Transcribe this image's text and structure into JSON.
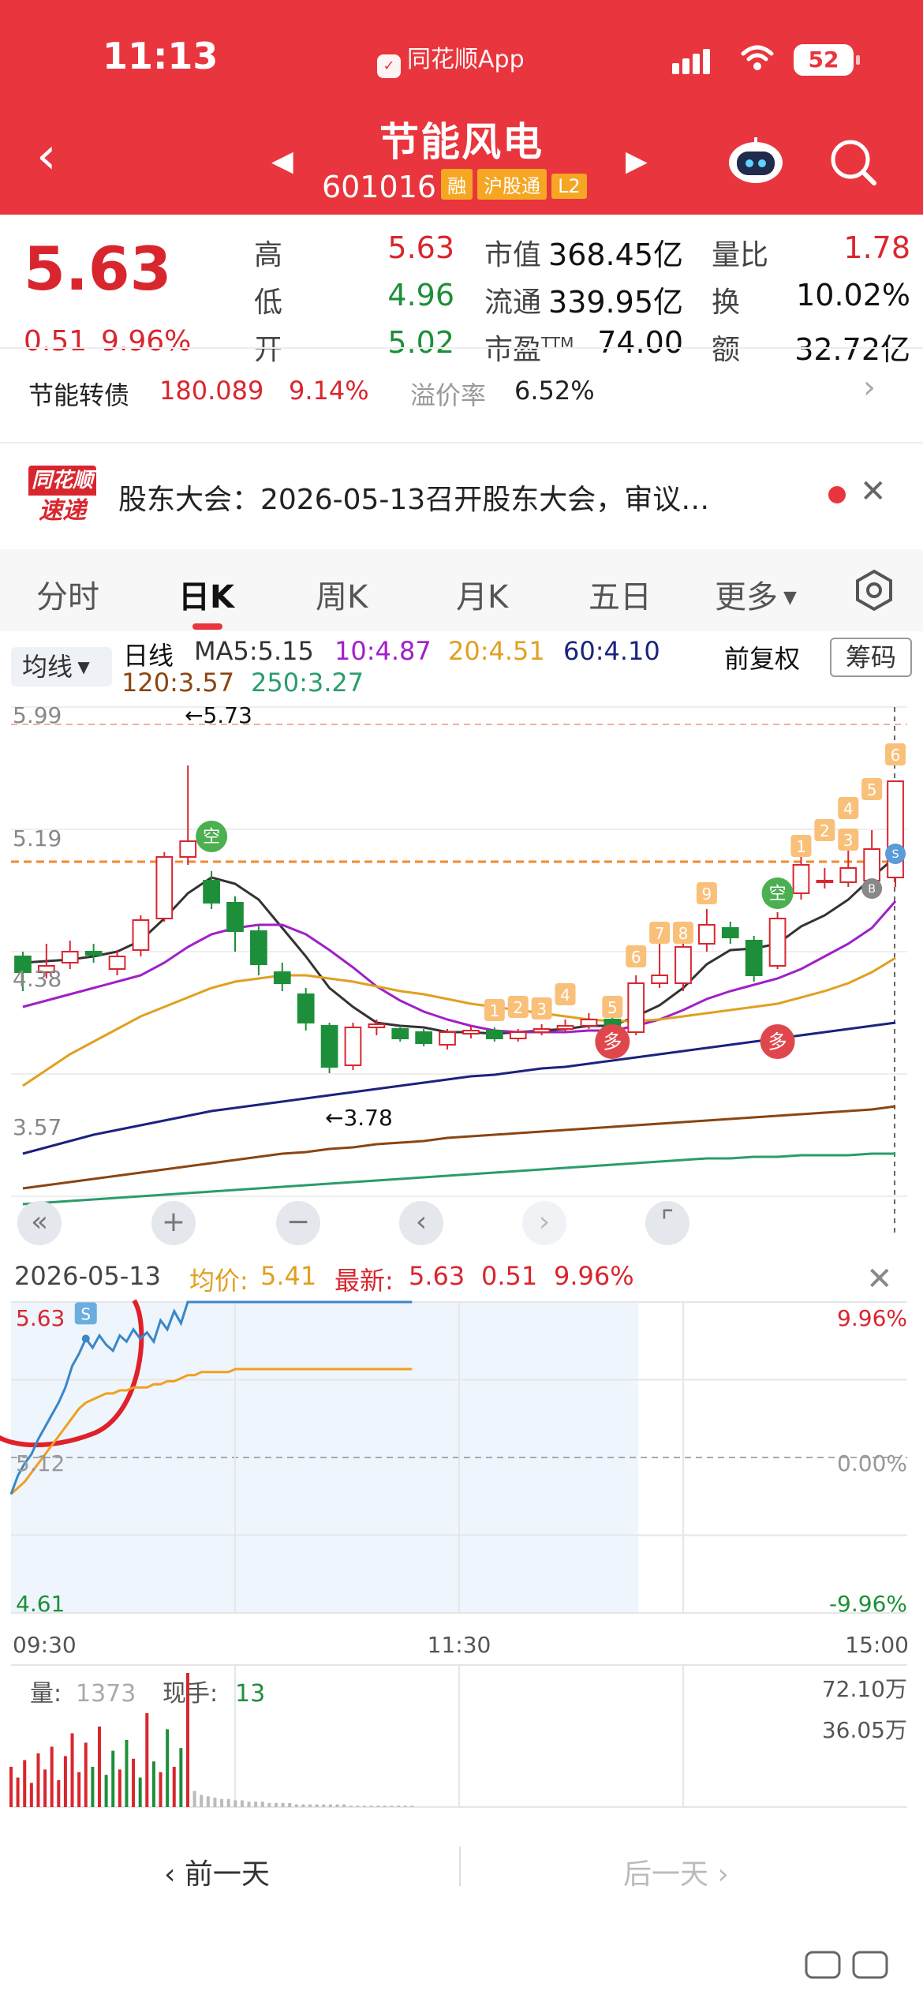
{
  "status_bar": {
    "time": "11:13",
    "app_name": "同花顺App",
    "battery": "52"
  },
  "header": {
    "stock_name": "节能风电",
    "stock_code": "601016",
    "tags": [
      "融",
      "沪股通",
      "L2"
    ]
  },
  "quote": {
    "price": "5.63",
    "change": "0.51",
    "change_pct": "9.96%",
    "high_label": "高",
    "high": "5.63",
    "low_label": "低",
    "low": "4.96",
    "open_label": "开",
    "open": "5.02",
    "mktcap_label": "市值",
    "mktcap": "368.45亿",
    "float_label": "流通",
    "float": "339.95亿",
    "pe_label": "市盈",
    "pe_suffix": "TTM",
    "pe": "74.00",
    "volratio_label": "量比",
    "volratio": "1.78",
    "turnover_label": "换",
    "turnover": "10.02%",
    "amount_label": "额",
    "amount": "32.72亿"
  },
  "bond": {
    "name": "节能转债",
    "price": "180.089",
    "pct": "9.14%",
    "premium_label": "溢价率",
    "premium": "6.52%"
  },
  "news": {
    "logo_top": "同花顺",
    "logo_bottom": "速递",
    "text": "股东大会：2026-05-13召开股东大会，审议…"
  },
  "tabs": [
    "分时",
    "日K",
    "周K",
    "月K",
    "五日",
    "更多"
  ],
  "ma_bar": {
    "select": "均线",
    "period": "日线",
    "ma5": "MA5:5.15",
    "ma10": "10:4.87",
    "ma20": "20:4.51",
    "ma60": "60:4.10",
    "ma120": "120:3.57",
    "ma250": "250:3.27",
    "adjust": "前复权",
    "chips": "筹码"
  },
  "kline": {
    "y_labels": [
      "5.99",
      "5.19",
      "4.38",
      "3.57"
    ],
    "high_note": "←5.73",
    "low_note": "←3.78",
    "markers": [
      "空",
      "多",
      "S",
      "B"
    ],
    "counts": [
      "1",
      "2",
      "3",
      "4",
      "5",
      "6",
      "7",
      "8",
      "9"
    ]
  },
  "kline_data": {
    "type": "candlestick",
    "candles": [
      [
        4.52,
        4.42,
        4.55,
        4.3
      ],
      [
        4.42,
        4.46,
        4.6,
        4.38
      ],
      [
        4.48,
        4.55,
        4.62,
        4.44
      ],
      [
        4.55,
        4.53,
        4.6,
        4.48
      ],
      [
        4.44,
        4.52,
        4.56,
        4.4
      ],
      [
        4.56,
        4.75,
        4.78,
        4.52
      ],
      [
        4.76,
        5.15,
        5.18,
        4.74
      ],
      [
        5.15,
        5.25,
        5.73,
        5.1
      ],
      [
        5.0,
        4.86,
        5.06,
        4.82
      ],
      [
        4.86,
        4.68,
        4.9,
        4.55
      ],
      [
        4.68,
        4.47,
        4.72,
        4.4
      ],
      [
        4.42,
        4.35,
        4.48,
        4.3
      ],
      [
        4.28,
        4.1,
        4.32,
        4.05
      ],
      [
        4.08,
        3.82,
        4.1,
        3.78
      ],
      [
        3.83,
        4.07,
        4.1,
        3.8
      ],
      [
        4.07,
        4.09,
        4.12,
        4.02
      ],
      [
        4.06,
        4.0,
        4.08,
        3.98
      ],
      [
        4.04,
        3.97,
        4.06,
        3.95
      ],
      [
        3.96,
        4.04,
        4.06,
        3.93
      ],
      [
        4.03,
        4.05,
        4.08,
        4.0
      ],
      [
        4.05,
        4.0,
        4.07,
        3.98
      ],
      [
        4.0,
        4.04,
        4.06,
        3.98
      ],
      [
        4.04,
        4.06,
        4.09,
        4.02
      ],
      [
        4.06,
        4.08,
        4.12,
        4.04
      ],
      [
        4.08,
        4.12,
        4.16,
        4.06
      ],
      [
        4.12,
        4.04,
        4.14,
        4.02
      ],
      [
        4.04,
        4.35,
        4.4,
        4.02
      ],
      [
        4.35,
        4.4,
        4.6,
        4.32
      ],
      [
        4.35,
        4.58,
        4.62,
        4.3
      ],
      [
        4.6,
        4.72,
        4.82,
        4.55
      ],
      [
        4.7,
        4.64,
        4.74,
        4.6
      ],
      [
        4.62,
        4.4,
        4.65,
        4.36
      ],
      [
        4.46,
        4.76,
        4.8,
        4.44
      ],
      [
        4.92,
        5.1,
        5.15,
        4.88
      ],
      [
        5.0,
        5.0,
        5.08,
        4.95
      ],
      [
        4.99,
        5.08,
        5.22,
        4.96
      ],
      [
        5.0,
        5.2,
        5.32,
        4.98
      ],
      [
        5.02,
        5.63,
        5.63,
        4.96
      ]
    ],
    "ma_lines": {
      "ma5": [
        4.48,
        4.49,
        4.5,
        4.52,
        4.55,
        4.62,
        4.76,
        4.92,
        5.02,
        4.98,
        4.88,
        4.7,
        4.52,
        4.32,
        4.2,
        4.1,
        4.08,
        4.07,
        4.04,
        4.04,
        4.03,
        4.04,
        4.05,
        4.06,
        4.08,
        4.08,
        4.14,
        4.21,
        4.32,
        4.47,
        4.56,
        4.57,
        4.6,
        4.71,
        4.78,
        4.88,
        5.02,
        5.15
      ],
      "ma10": [
        4.2,
        4.24,
        4.28,
        4.32,
        4.36,
        4.4,
        4.48,
        4.58,
        4.66,
        4.7,
        4.72,
        4.72,
        4.66,
        4.56,
        4.45,
        4.33,
        4.24,
        4.17,
        4.12,
        4.08,
        4.05,
        4.04,
        4.04,
        4.04,
        4.05,
        4.05,
        4.08,
        4.12,
        4.18,
        4.25,
        4.3,
        4.34,
        4.38,
        4.44,
        4.52,
        4.6,
        4.7,
        4.87
      ],
      "ma20": [
        3.7,
        3.8,
        3.9,
        3.98,
        4.06,
        4.14,
        4.2,
        4.26,
        4.32,
        4.36,
        4.38,
        4.4,
        4.4,
        4.38,
        4.36,
        4.33,
        4.3,
        4.28,
        4.25,
        4.22,
        4.2,
        4.18,
        4.16,
        4.14,
        4.12,
        4.11,
        4.11,
        4.12,
        4.14,
        4.16,
        4.18,
        4.2,
        4.22,
        4.26,
        4.3,
        4.35,
        4.42,
        4.51
      ],
      "ma60": [
        3.27,
        3.31,
        3.35,
        3.39,
        3.42,
        3.45,
        3.48,
        3.51,
        3.54,
        3.56,
        3.58,
        3.6,
        3.62,
        3.64,
        3.66,
        3.68,
        3.7,
        3.72,
        3.74,
        3.76,
        3.77,
        3.79,
        3.81,
        3.82,
        3.84,
        3.86,
        3.88,
        3.9,
        3.92,
        3.94,
        3.96,
        3.98,
        4.0,
        4.02,
        4.04,
        4.06,
        4.08,
        4.1
      ],
      "ma120": [
        3.05,
        3.07,
        3.09,
        3.11,
        3.13,
        3.15,
        3.17,
        3.19,
        3.21,
        3.23,
        3.25,
        3.27,
        3.28,
        3.3,
        3.31,
        3.33,
        3.34,
        3.35,
        3.37,
        3.38,
        3.39,
        3.4,
        3.41,
        3.42,
        3.43,
        3.44,
        3.45,
        3.46,
        3.47,
        3.48,
        3.49,
        3.5,
        3.51,
        3.52,
        3.53,
        3.54,
        3.55,
        3.57
      ],
      "ma250": [
        2.95,
        2.96,
        2.97,
        2.98,
        2.99,
        3.0,
        3.01,
        3.02,
        3.03,
        3.04,
        3.05,
        3.06,
        3.07,
        3.08,
        3.09,
        3.1,
        3.11,
        3.12,
        3.13,
        3.14,
        3.15,
        3.16,
        3.17,
        3.18,
        3.19,
        3.2,
        3.21,
        3.22,
        3.23,
        3.24,
        3.24,
        3.25,
        3.25,
        3.26,
        3.26,
        3.26,
        3.27,
        3.27
      ]
    },
    "ylim": [
      3.0,
      6.1
    ]
  },
  "intraday": {
    "date": "2026-05-13",
    "avg_label": "均价:",
    "avg": "5.41",
    "latest_label": "最新:",
    "latest": "5.63",
    "latest_chg": "0.51",
    "latest_pct": "9.96%",
    "y_left": [
      "5.63",
      "5.12",
      "4.61"
    ],
    "y_right": [
      "9.96%",
      "0.00%",
      "-9.96%"
    ],
    "x_labels": [
      "09:30",
      "11:30",
      "15:00"
    ],
    "vol_label": "量:",
    "vol": "1373",
    "hand_label": "现手:",
    "hand": "13",
    "vol_scale": [
      "72.10万",
      "36.05万"
    ]
  },
  "intraday_data": {
    "type": "line",
    "price": [
      5.0,
      5.06,
      5.1,
      5.13,
      5.18,
      5.22,
      5.26,
      5.3,
      5.35,
      5.42,
      5.46,
      5.51,
      5.48,
      5.52,
      5.49,
      5.47,
      5.52,
      5.5,
      5.54,
      5.51,
      5.53,
      5.5,
      5.57,
      5.54,
      5.6,
      5.56,
      5.63,
      5.63,
      5.63,
      5.63,
      5.63,
      5.63,
      5.63,
      5.63,
      5.63,
      5.63,
      5.63,
      5.63,
      5.63,
      5.63,
      5.63,
      5.63,
      5.63,
      5.63,
      5.63,
      5.63,
      5.63,
      5.63,
      5.63,
      5.63,
      5.63,
      5.63,
      5.63,
      5.63,
      5.63,
      5.63,
      5.63,
      5.63,
      5.63,
      5.63
    ],
    "avg": [
      5.0,
      5.02,
      5.04,
      5.07,
      5.1,
      5.13,
      5.16,
      5.19,
      5.22,
      5.25,
      5.28,
      5.3,
      5.31,
      5.32,
      5.33,
      5.33,
      5.34,
      5.34,
      5.35,
      5.35,
      5.35,
      5.36,
      5.36,
      5.37,
      5.37,
      5.38,
      5.39,
      5.39,
      5.4,
      5.4,
      5.4,
      5.4,
      5.4,
      5.41,
      5.41,
      5.41,
      5.41,
      5.41,
      5.41,
      5.41,
      5.41,
      5.41,
      5.41,
      5.41,
      5.41,
      5.41,
      5.41,
      5.41,
      5.41,
      5.41,
      5.41,
      5.41,
      5.41,
      5.41,
      5.41,
      5.41,
      5.41,
      5.41,
      5.41,
      5.41
    ],
    "volume": [
      30,
      22,
      35,
      18,
      40,
      28,
      45,
      20,
      38,
      55,
      26,
      48,
      30,
      60,
      24,
      42,
      28,
      50,
      36,
      22,
      70,
      34,
      26,
      58,
      30,
      44,
      100,
      12,
      9,
      8,
      7,
      6,
      6,
      5,
      5,
      4,
      4,
      4,
      3,
      3,
      3,
      3,
      2,
      2,
      2,
      2,
      2,
      2,
      2,
      2,
      1,
      1,
      1,
      1,
      1,
      1,
      1,
      1,
      1,
      1
    ],
    "ylim": [
      4.61,
      5.63
    ]
  },
  "nav": {
    "prev_day": "前一天",
    "next_day": "后一天"
  },
  "colors": {
    "brand": "#e9353d",
    "up": "#d9262e",
    "down": "#1d8f3a",
    "ma5": "#333333",
    "ma10": "#a020c8",
    "ma20": "#e0a020",
    "ma60": "#1a237e",
    "ma120": "#8b4513",
    "ma250": "#2a9d6a"
  }
}
